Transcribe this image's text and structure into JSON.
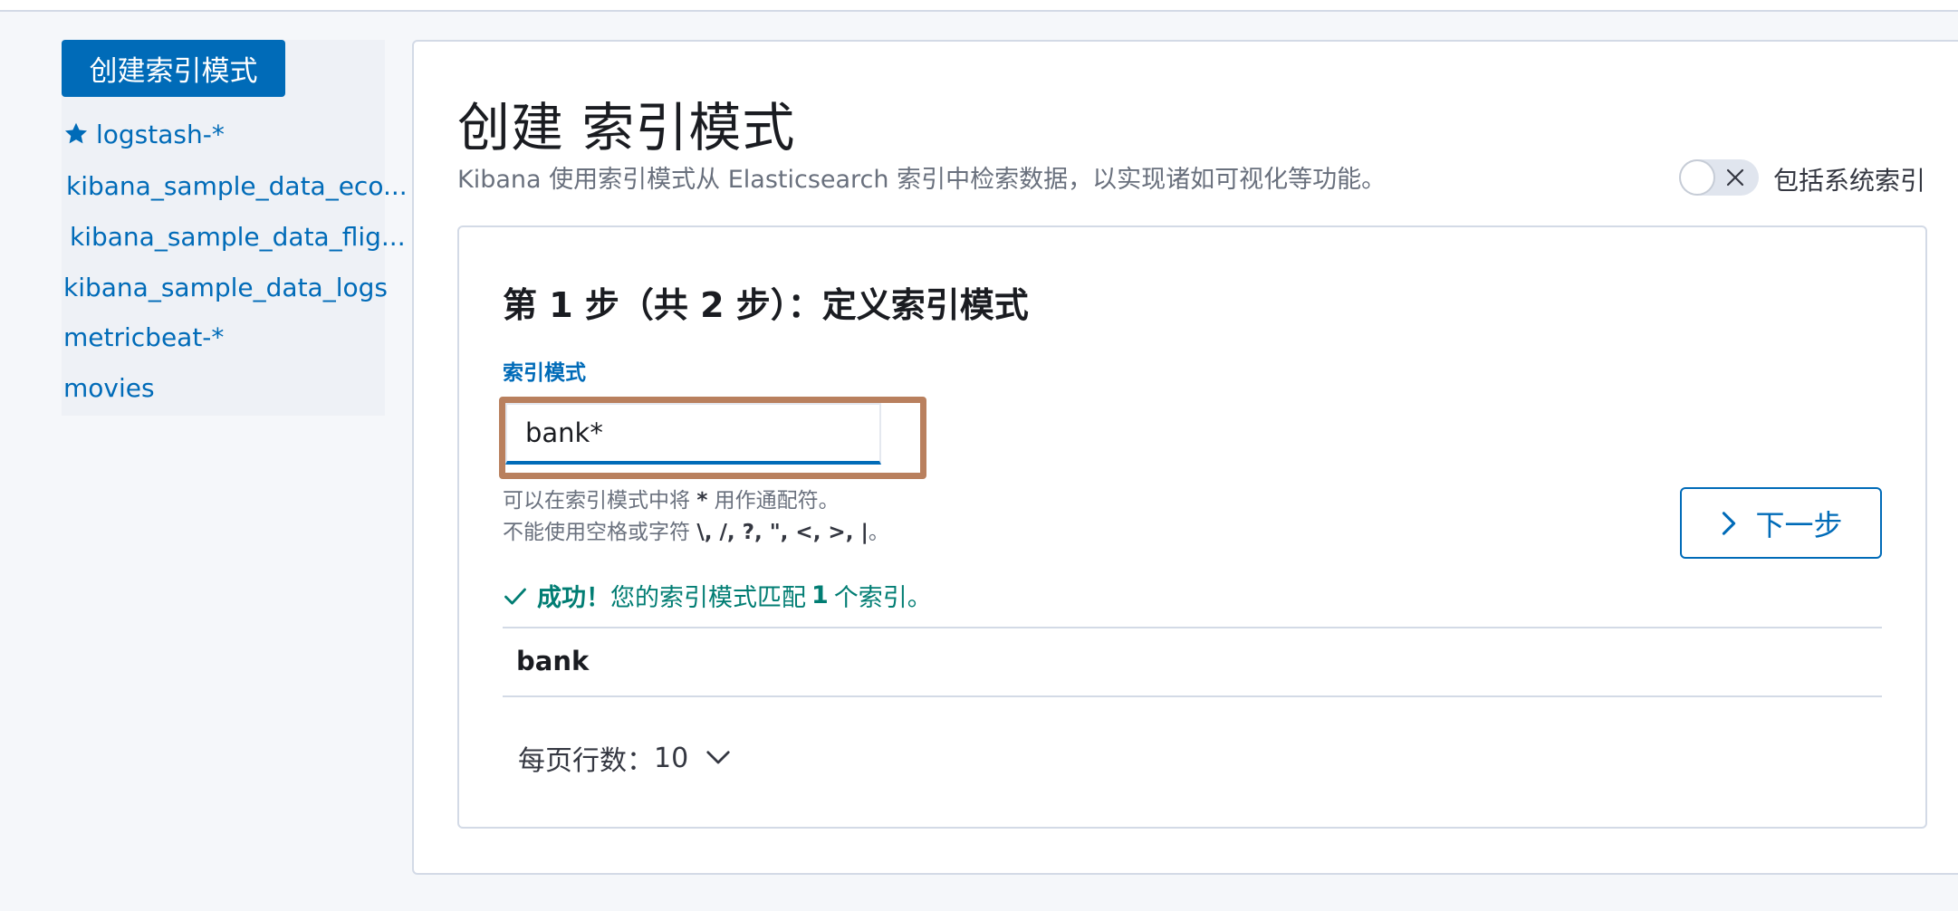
{
  "sidebar": {
    "create_button": "创建索引模式",
    "items": [
      {
        "label": "logstash-*",
        "default": true
      },
      {
        "label": "kibana_sample_data_eco..."
      },
      {
        "label": "kibana_sample_data_flig..."
      },
      {
        "label": "kibana_sample_data_logs"
      },
      {
        "label": "metricbeat-*"
      },
      {
        "label": "movies"
      }
    ]
  },
  "main": {
    "title": "创建 索引模式",
    "description": "Kibana 使用索引模式从 Elasticsearch 索引中检索数据，以实现诸如可视化等功能。",
    "include_system_toggle": {
      "label": "包括系统索引",
      "on": false
    },
    "step": {
      "title": "第 1 步（共 2 步）：定义索引模式",
      "field_label": "索引模式",
      "input_value": "bank*",
      "help_line1_prefix": "可以在索引模式中将",
      "help_line1_star": "*",
      "help_line1_suffix": "用作通配符。",
      "help_line2_prefix": "不能使用空格或字符",
      "help_line2_chars": "\\, /, ?, \", <, >, |",
      "help_line2_suffix": "。",
      "next_button": "下一步",
      "success_bold": "成功！",
      "success_text_a": "您的索引模式匹配",
      "success_count": "1",
      "success_text_b": "个索引。",
      "matched_indices": [
        "bank"
      ],
      "rows_per_page_label": "每页行数：",
      "rows_per_page_value": "10"
    }
  },
  "colors": {
    "primary": "#006bb8",
    "success": "#017d73",
    "highlight": "#b9805e"
  },
  "icons": [
    "star-icon",
    "close-icon",
    "chevron-right-icon",
    "check-icon",
    "chevron-down-icon"
  ]
}
